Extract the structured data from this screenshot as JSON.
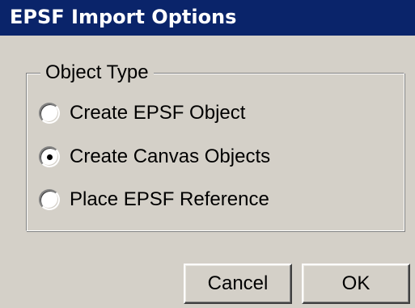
{
  "window": {
    "title": "EPSF Import Options"
  },
  "object_type": {
    "legend": "Object Type",
    "options": [
      {
        "label": "Create EPSF Object",
        "selected": false
      },
      {
        "label": "Create Canvas Objects",
        "selected": true
      },
      {
        "label": "Place EPSF Reference",
        "selected": false
      }
    ]
  },
  "buttons": {
    "cancel_label": "Cancel",
    "ok_label": "OK"
  },
  "colors": {
    "titlebar": "#0a246a",
    "dialog_face": "#d4d0c8"
  }
}
